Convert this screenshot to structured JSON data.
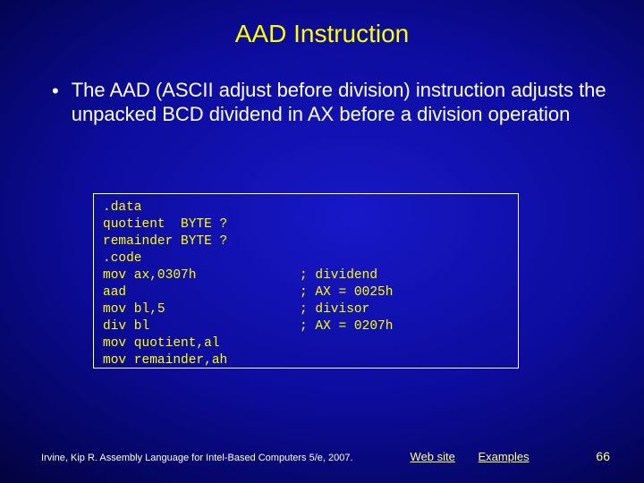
{
  "title": "AAD Instruction",
  "bullet_text": "The AAD (ASCII adjust before division) instruction adjusts the unpacked BCD dividend in AX before a division operation",
  "code": {
    "l0": ".data",
    "l1": "quotient  BYTE ?",
    "l2": "remainder BYTE ?",
    "l3": ".code",
    "l4": "mov ax,0307h",
    "c4": "; dividend",
    "l5": "aad",
    "c5": "; AX = 0025h",
    "l6": "mov bl,5",
    "c6": "; divisor",
    "l7": "div bl",
    "c7": "; AX = 0207h",
    "l8": "mov quotient,al",
    "l9": "mov remainder,ah"
  },
  "footer": {
    "citation": "Irvine, Kip R. Assembly Language for Intel-Based Computers 5/e, 2007.",
    "link_web": "Web site",
    "link_examples": "Examples",
    "page": "66"
  }
}
